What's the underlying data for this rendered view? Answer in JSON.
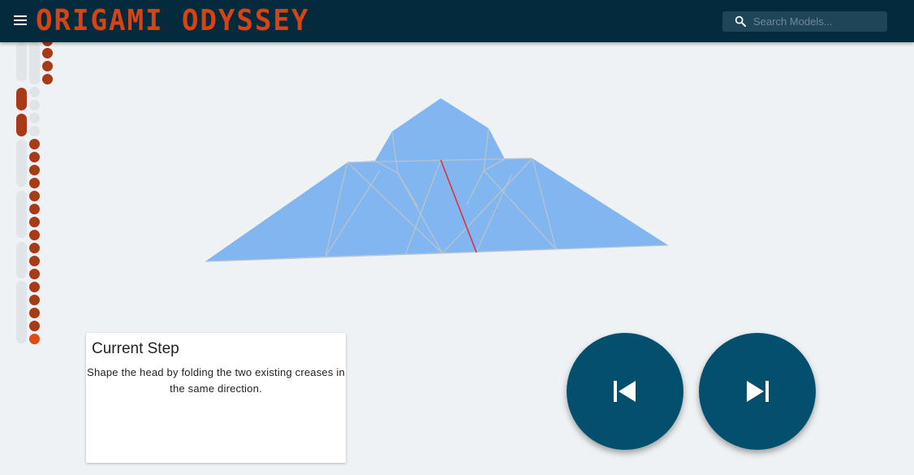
{
  "header": {
    "title": "ORIGAMI ODYSSEY",
    "search_placeholder": "Search Models..."
  },
  "icons": {
    "menu": "menu-icon",
    "search": "search-icon",
    "previous": "skip-previous-icon",
    "next": "skip-next-icon"
  },
  "colors": {
    "header_bg": "#032a3d",
    "title": "#d84315",
    "step_done": "#a83a17",
    "step_current": "#e24a14",
    "nav_button": "#02506d",
    "paper": "#82b6f0",
    "active_crease": "#e0303a"
  },
  "current_step": {
    "heading": "Current Step",
    "text": "Shape the head by folding the two existing creases in the same direction."
  }
}
